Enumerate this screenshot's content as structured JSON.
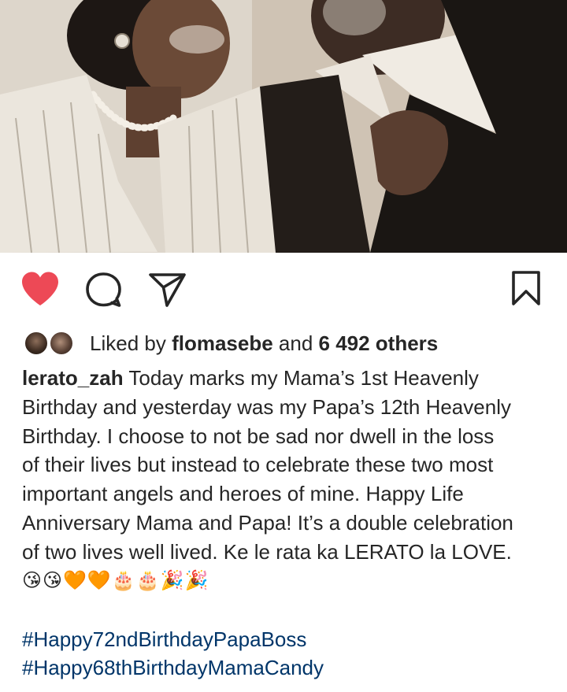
{
  "post": {
    "liked_prefix": "Liked by ",
    "liked_user": "flomasebe",
    "liked_and": " and ",
    "liked_others": "6 492 others",
    "username": "lerato_zah",
    "caption_lines": [
      " Today marks my Mama’s 1st Heavenly",
      "Birthday and yesterday was my Papa’s 12th Heavenly",
      "Birthday. I choose to not be sad nor dwell in the loss",
      "of their lives but instead to celebrate these two most",
      "important angels and heroes of mine. Happy Life",
      "Anniversary Mama and Papa! It’s a double celebration",
      "of two lives well lived. Ke le rata ka LERATO la LOVE."
    ],
    "emojis": "😘😘🧡🧡🎂🎂🎉🎉",
    "hashtags": [
      "#Happy72ndBirthdayPapaBoss",
      "#Happy68thBirthdayMamaCandy"
    ]
  },
  "colors": {
    "like": "#ed4956",
    "hashtag": "#003569",
    "text": "#262626"
  },
  "icons": [
    "heart-icon",
    "comment-icon",
    "share-icon",
    "bookmark-icon"
  ]
}
